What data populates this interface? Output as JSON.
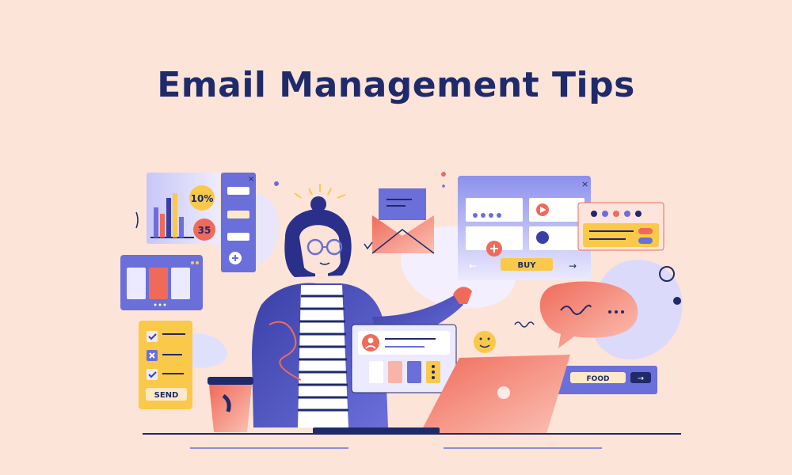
{
  "page": {
    "title": "Email Management Tips",
    "background": "#fce4d8",
    "title_color": "#1f2a6b"
  },
  "illustration": {
    "chart_card": {
      "badge_top": "10%",
      "badge_bottom": "35"
    },
    "checklist_card": {
      "send_label": "SEND"
    },
    "buy_panel": {
      "buy_label": "BUY"
    },
    "food_bar": {
      "food_label": "FOOD"
    },
    "icons": [
      "envelope-icon",
      "play-icon",
      "phone-icon",
      "plus-icon",
      "smiley-icon",
      "user-icon",
      "chat-bubble-icon",
      "coffee-cup-icon",
      "laptop-icon"
    ],
    "palette": {
      "navy": "#1f2a6b",
      "violet": "#6b6fd9",
      "lavender": "#c9c8f5",
      "coral": "#f06a5a",
      "yellow": "#fbc94a",
      "cream": "#fde9c7"
    }
  }
}
